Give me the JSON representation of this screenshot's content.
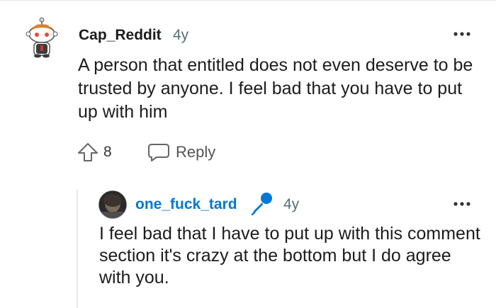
{
  "comments": [
    {
      "username": "Cap_Reddit",
      "age": "4y",
      "text": "A person that entitled does not even deserve to be trusted by anyone. I feel bad that you have to put up with him",
      "score": "8",
      "reply_label": "Reply",
      "avatar_icon": "snoo-avatar-icon"
    },
    {
      "username": "one_fuck_tard",
      "age": "4y",
      "text": "I feel bad that I have to put up with this comment section it's crazy at the bottom but I do agree with you.",
      "flair_icon": "microphone-icon",
      "avatar_icon": "user-photo-avatar"
    }
  ],
  "colors": {
    "username_op": "#1c1c1c",
    "username_reply": "#0079d3",
    "meta": "#576f76",
    "mic": "#0079d3"
  }
}
